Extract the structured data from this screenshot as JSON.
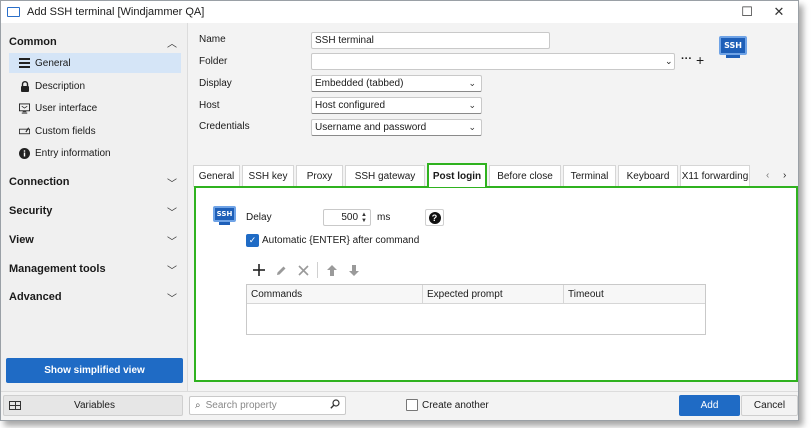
{
  "window": {
    "title": "Add SSH terminal [Windjammer QA]",
    "maximize_glyph": "☐",
    "close_glyph": "✕"
  },
  "sidebar": {
    "groups": [
      {
        "label": "Common",
        "expanded": true
      },
      {
        "label": "Connection",
        "expanded": false
      },
      {
        "label": "Security",
        "expanded": false
      },
      {
        "label": "View",
        "expanded": false
      },
      {
        "label": "Management tools",
        "expanded": false
      },
      {
        "label": "Advanced",
        "expanded": false
      }
    ],
    "expanded_glyph": "︿",
    "collapsed_glyph": "﹀",
    "items": [
      {
        "label": "General",
        "icon": "list-icon",
        "selected": true
      },
      {
        "label": "Description",
        "icon": "lock-icon",
        "selected": false
      },
      {
        "label": "User interface",
        "icon": "monitor-icon",
        "selected": false
      },
      {
        "label": "Custom fields",
        "icon": "pencil-field-icon",
        "selected": false
      },
      {
        "label": "Entry information",
        "icon": "info-icon",
        "selected": false
      }
    ],
    "simplified_button": "Show simplified view"
  },
  "properties": {
    "name_label": "Name",
    "name_value": "SSH terminal",
    "folder_label": "Folder",
    "folder_value": "",
    "display_label": "Display",
    "display_value": "Embedded (tabbed)",
    "host_label": "Host",
    "host_value": "Host configured",
    "credentials_label": "Credentials",
    "credentials_value": "Username and password",
    "entry_icon_text": "SSH"
  },
  "tabs": [
    {
      "label": "General",
      "active": false
    },
    {
      "label": "SSH key",
      "active": false
    },
    {
      "label": "Proxy",
      "active": false
    },
    {
      "label": "SSH gateway",
      "active": false
    },
    {
      "label": "Post login",
      "active": true
    },
    {
      "label": "Before close",
      "active": false
    },
    {
      "label": "Terminal",
      "active": false
    },
    {
      "label": "Keyboard",
      "active": false
    },
    {
      "label": "X11 forwarding",
      "active": false
    }
  ],
  "post_login": {
    "icon_text": "SSH",
    "delay_label": "Delay",
    "delay_value": "500",
    "delay_unit": "ms",
    "auto_enter_label": "Automatic {ENTER} after command",
    "auto_enter_checked": true,
    "columns": [
      "Commands",
      "Expected prompt",
      "Timeout"
    ]
  },
  "bottom": {
    "variables_label": "Variables",
    "search_placeholder": "Search property",
    "create_another_label": "Create another",
    "add_label": "Add",
    "cancel_label": "Cancel"
  },
  "colors": {
    "accent": "#1f6bc5",
    "highlight": "#2fb21f",
    "selected_item": "#d5e5f7"
  }
}
